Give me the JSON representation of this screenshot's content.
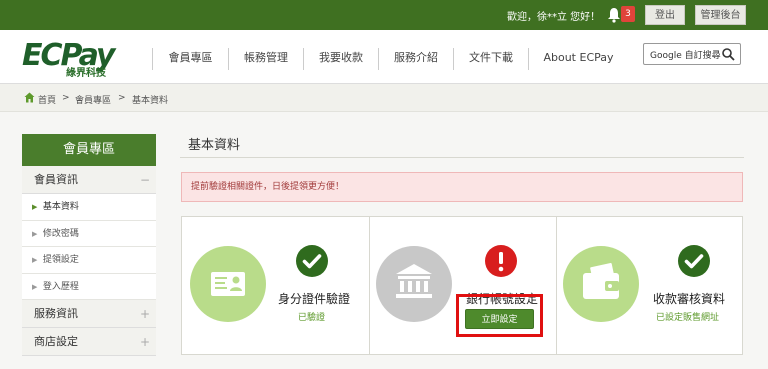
{
  "topbar": {
    "greeting": "歡迎，徐**立 您好！",
    "notification_count": "3",
    "logout_label": "登出",
    "admin_label": "管理後台"
  },
  "logo": {
    "text": "ECPay",
    "sub": "綠界科技"
  },
  "nav": {
    "items": [
      "會員專區",
      "帳務管理",
      "我要收款",
      "服務介紹",
      "文件下載",
      "About ECPay"
    ]
  },
  "search": {
    "placeholder": "Google 自訂搜尋"
  },
  "breadcrumb": {
    "home": "首頁",
    "sep": ">",
    "member": "會員專區",
    "current": "基本資料"
  },
  "sidebar": {
    "title": "會員專區",
    "sections": [
      {
        "label": "會員資訊",
        "toggle": "−"
      },
      {
        "label": "服務資訊",
        "toggle": "+"
      },
      {
        "label": "商店設定",
        "toggle": "+"
      }
    ],
    "sub_items": [
      "基本資料",
      "修改密碼",
      "提領設定",
      "登入歷程"
    ],
    "sub_arrow": "▶"
  },
  "main": {
    "title": "基本資料",
    "alert": "提前驗證相關證件，日後提領更方便！",
    "cards": [
      {
        "label": "身分證件驗證",
        "note": "已驗證",
        "icon": "id-card-icon",
        "status": "check-icon"
      },
      {
        "label": "銀行帳號設定",
        "button": "立即設定",
        "icon": "bank-icon",
        "status": "alert-icon"
      },
      {
        "label": "收款審核資料",
        "note": "已設定販售網址",
        "icon": "wallet-icon",
        "status": "check-icon"
      }
    ]
  },
  "colors": {
    "brand_green": "#3f7021",
    "check_green": "#2f6b1e",
    "alert_red": "#d81e1e",
    "circle_green": "#b9dc8a",
    "circle_gray": "#c8c8c8",
    "highlight": "#e01010"
  }
}
